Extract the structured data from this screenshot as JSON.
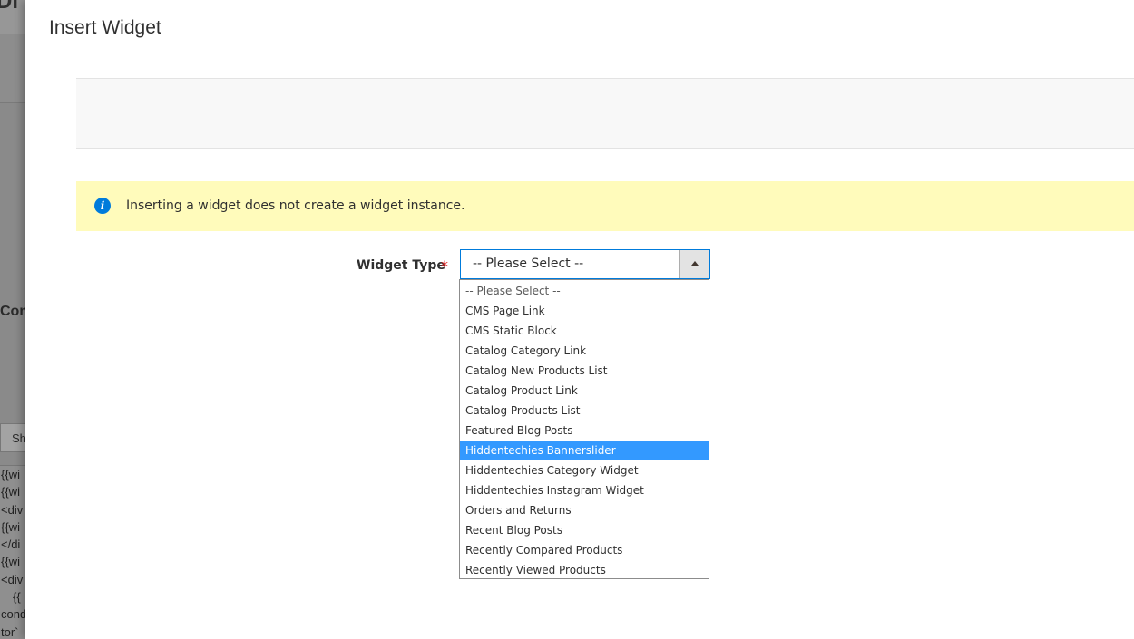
{
  "background": {
    "header_fragment": "Di",
    "section_fragment": "Con",
    "button_fragment": "Sh",
    "code_lines": [
      "{{wi",
      "{{wi",
      "<div",
      "{{wi",
      "</di",
      "{{wi",
      "<div",
      "{{",
      "cond",
      "tor`"
    ]
  },
  "modal": {
    "title": "Insert Widget",
    "notice": {
      "icon": "info-icon",
      "text": "Inserting a widget does not create a widget instance."
    },
    "field": {
      "label": "Widget Type",
      "required_marker": "*",
      "selected_value": "-- Please Select --",
      "options": [
        "-- Please Select --",
        "CMS Page Link",
        "CMS Static Block",
        "Catalog Category Link",
        "Catalog New Products List",
        "Catalog Product Link",
        "Catalog Products List",
        "Featured Blog Posts",
        "Hiddentechies Bannerslider",
        "Hiddentechies Category Widget",
        "Hiddentechies Instagram Widget",
        "Orders and Returns",
        "Recent Blog Posts",
        "Recently Compared Products",
        "Recently Viewed Products"
      ],
      "highlighted_option": "Hiddentechies Bannerslider"
    }
  },
  "colors": {
    "notice_bg": "#fffbbb",
    "info_icon": "#007bdb",
    "focus_border": "#007bdb",
    "highlight": "#3399ff",
    "required": "#e22626"
  }
}
